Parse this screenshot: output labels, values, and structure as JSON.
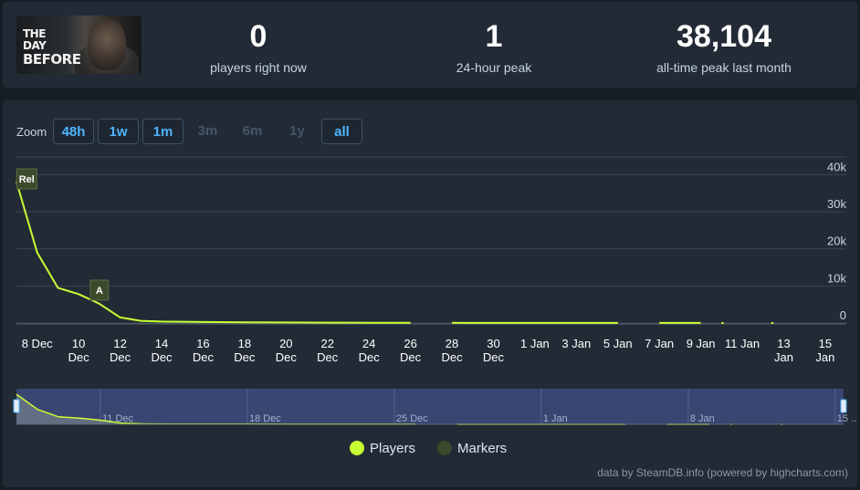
{
  "game": {
    "logo_line1": "THE DAY",
    "logo_line2": "BEFORE"
  },
  "stats": [
    {
      "value": "0",
      "label": "players right now"
    },
    {
      "value": "1",
      "label": "24-hour peak"
    },
    {
      "value": "38,104",
      "label": "all-time peak last month"
    }
  ],
  "zoom": {
    "label": "Zoom",
    "buttons": [
      {
        "label": "48h",
        "state": "active"
      },
      {
        "label": "1w",
        "state": "active"
      },
      {
        "label": "1m",
        "state": "active"
      },
      {
        "label": "3m",
        "state": "disabled"
      },
      {
        "label": "6m",
        "state": "disabled"
      },
      {
        "label": "1y",
        "state": "disabled"
      },
      {
        "label": "all",
        "state": "active"
      }
    ]
  },
  "legend": {
    "players": "Players",
    "markers": "Markers"
  },
  "credit": "data by SteamDB.info (powered by highcharts.com)",
  "colors": {
    "line": "#c8ff33",
    "marker": "#3b4a2b",
    "accent": "#4fb4ff",
    "navigator_bg": "#3a4572"
  },
  "chart_data": {
    "type": "line",
    "y_ticks": [
      "0",
      "10k",
      "20k",
      "30k",
      "40k"
    ],
    "ylim": [
      0,
      45000
    ],
    "x_ticks": [
      {
        "day": 8,
        "l1": "8 Dec",
        "l2": ""
      },
      {
        "day": 10,
        "l1": "10",
        "l2": "Dec"
      },
      {
        "day": 12,
        "l1": "12",
        "l2": "Dec"
      },
      {
        "day": 14,
        "l1": "14",
        "l2": "Dec"
      },
      {
        "day": 16,
        "l1": "16",
        "l2": "Dec"
      },
      {
        "day": 18,
        "l1": "18",
        "l2": "Dec"
      },
      {
        "day": 20,
        "l1": "20",
        "l2": "Dec"
      },
      {
        "day": 22,
        "l1": "22",
        "l2": "Dec"
      },
      {
        "day": 24,
        "l1": "24",
        "l2": "Dec"
      },
      {
        "day": 26,
        "l1": "26",
        "l2": "Dec"
      },
      {
        "day": 28,
        "l1": "28",
        "l2": "Dec"
      },
      {
        "day": 30,
        "l1": "30",
        "l2": "Dec"
      },
      {
        "day": 32,
        "l1": "1 Jan",
        "l2": ""
      },
      {
        "day": 34,
        "l1": "3 Jan",
        "l2": ""
      },
      {
        "day": 36,
        "l1": "5 Jan",
        "l2": ""
      },
      {
        "day": 38,
        "l1": "7 Jan",
        "l2": ""
      },
      {
        "day": 40,
        "l1": "9 Jan",
        "l2": ""
      },
      {
        "day": 42,
        "l1": "11 Jan",
        "l2": ""
      },
      {
        "day": 44,
        "l1": "13",
        "l2": "Jan"
      },
      {
        "day": 46,
        "l1": "15",
        "l2": "Jan"
      }
    ],
    "series": [
      {
        "name": "Players",
        "segments": [
          [
            [
              7.0,
              38104
            ],
            [
              8.0,
              19000
            ],
            [
              9.0,
              9500
            ],
            [
              10.0,
              7800
            ],
            [
              11.0,
              5200
            ],
            [
              12.0,
              1500
            ],
            [
              13.0,
              600
            ],
            [
              14.0,
              400
            ],
            [
              16.0,
              280
            ],
            [
              18.0,
              200
            ],
            [
              20.0,
              150
            ],
            [
              22.0,
              110
            ],
            [
              24.0,
              80
            ],
            [
              26.0,
              60
            ]
          ],
          [
            [
              28.0,
              40
            ],
            [
              32.0,
              30
            ],
            [
              35.0,
              25
            ],
            [
              36.0,
              20
            ]
          ],
          [
            [
              38.0,
              20
            ],
            [
              40.0,
              15
            ]
          ],
          [
            [
              41.0,
              10
            ],
            [
              41.1,
              10
            ]
          ],
          [
            [
              43.4,
              10
            ],
            [
              43.5,
              10
            ]
          ]
        ]
      }
    ],
    "flags": [
      {
        "day": 7.1,
        "text": "Rel",
        "value": 38104
      },
      {
        "day": 11.0,
        "text": "A",
        "value": 5200
      }
    ],
    "navigator": {
      "labels": [
        {
          "day": 11,
          "text": "11 Dec"
        },
        {
          "day": 18,
          "text": "18 Dec"
        },
        {
          "day": 25,
          "text": "25 Dec"
        },
        {
          "day": 32,
          "text": "1 Jan"
        },
        {
          "day": 39,
          "text": "8 Jan"
        },
        {
          "day": 46,
          "text": "15 ..."
        }
      ]
    }
  }
}
